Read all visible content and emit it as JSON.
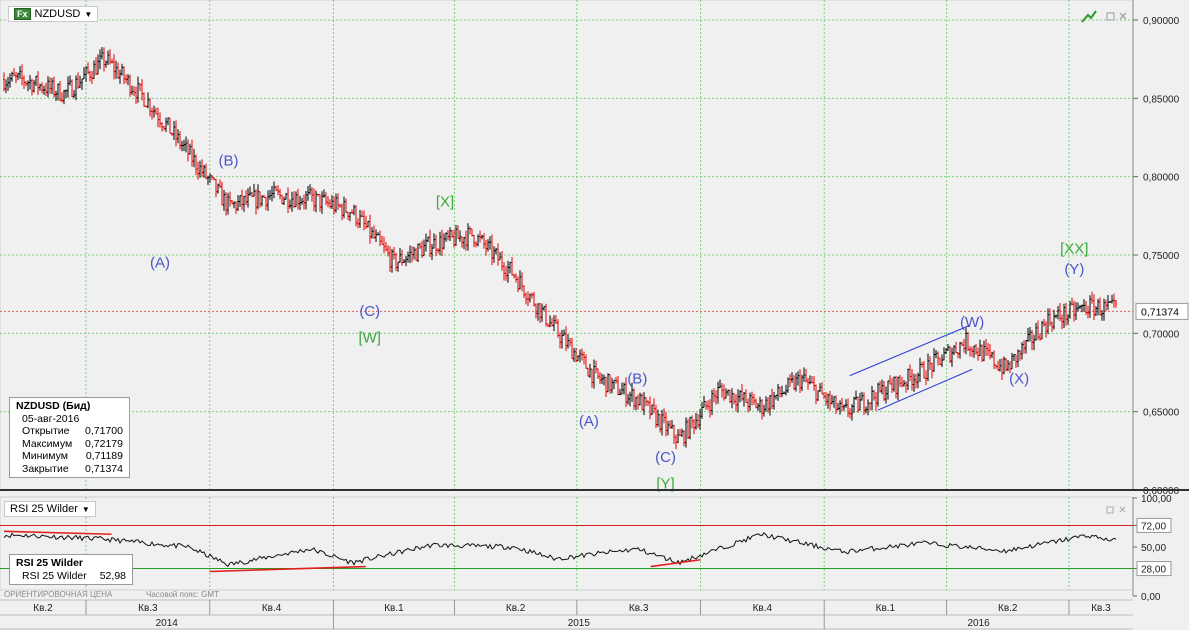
{
  "main_panel": {
    "symbol": "NZDUSD",
    "fx_icon_label": "Fx",
    "dropdown_icon": "triangle-down-icon",
    "toolbar_icons": [
      "trend-icon",
      "square-icon",
      "close-icon"
    ]
  },
  "info_box": {
    "title": "NZDUSD (Бид)",
    "date": "05-авг-2016",
    "rows": [
      {
        "label": "Открытие",
        "value": "0,71700"
      },
      {
        "label": "Максимум",
        "value": "0,72179"
      },
      {
        "label": "Минимум",
        "value": "0,71189"
      },
      {
        "label": "Закрытие",
        "value": "0,71374"
      }
    ]
  },
  "rsi_panel": {
    "label": "RSI 25 Wilder",
    "legend_title": "RSI 25 Wilder",
    "legend_label": "RSI 25 Wilder",
    "legend_value": "52,98",
    "level_high_label": "72,00",
    "level_low_label": "28,00",
    "axis_labels": [
      "100,00",
      "50,00",
      "0,00"
    ]
  },
  "footer": {
    "indicative_price": "ОРИЕНТИРОВОЧНАЯ ЦЕНА",
    "timezone": "Часовой пояс: GMT",
    "quarters": [
      "Кв.2",
      "Кв.3",
      "Кв.4",
      "Кв.1",
      "Кв.2",
      "Кв.3",
      "Кв.4",
      "Кв.1",
      "Кв.2",
      "Кв.3"
    ],
    "years": [
      "2014",
      "2015",
      "2016"
    ]
  },
  "colors": {
    "up_bar": "#000000",
    "down_bar": "#e00000",
    "wave_blue": "#4a55c8",
    "wave_green": "#3aa83a",
    "grid": "#7ccf7c",
    "price_line": "#e06060",
    "rsi_high": "#d02020",
    "rsi_low": "#20a020",
    "trend_red": "#e02020",
    "trend_blue": "#2838d8",
    "background": "#f0f0f0"
  },
  "chart_data": [
    {
      "type": "line",
      "series": [
        {
          "name": "NZDUSD",
          "x": [
            "2014-05",
            "2014-06",
            "2014-07",
            "2014-08",
            "2014-09",
            "2014-10",
            "2014-11",
            "2014-12",
            "2015-01",
            "2015-02",
            "2015-03",
            "2015-04",
            "2015-05",
            "2015-06",
            "2015-07",
            "2015-08",
            "2015-09",
            "2015-10",
            "2015-11",
            "2015-12",
            "2016-01",
            "2016-02",
            "2016-03",
            "2016-04",
            "2016-05",
            "2016-06",
            "2016-07",
            "2016-08"
          ],
          "values": [
            0.862,
            0.853,
            0.875,
            0.849,
            0.815,
            0.781,
            0.788,
            0.786,
            0.778,
            0.745,
            0.757,
            0.763,
            0.738,
            0.702,
            0.672,
            0.658,
            0.632,
            0.664,
            0.653,
            0.671,
            0.649,
            0.664,
            0.676,
            0.695,
            0.677,
            0.708,
            0.717,
            0.714
          ]
        }
      ],
      "ylim": [
        0.6,
        0.9
      ],
      "yticks": [
        "0,90000",
        "0,85000",
        "0,80000",
        "0,75000",
        "0,70000",
        "0,65000",
        "0,60000"
      ],
      "last_value_label": "0,71374",
      "annotations": [
        {
          "text": "(A)",
          "color": "blue",
          "x": "2014-08-25",
          "y": 0.742
        },
        {
          "text": "(B)",
          "color": "blue",
          "x": "2014-10-15",
          "y": 0.807
        },
        {
          "text": "[X]",
          "color": "green",
          "x": "2015-03-25",
          "y": 0.781
        },
        {
          "text": "(C)",
          "color": "blue",
          "x": "2015-01-28",
          "y": 0.711
        },
        {
          "text": "[W]",
          "color": "green",
          "x": "2015-01-28",
          "y": 0.694
        },
        {
          "text": "(B)",
          "color": "blue",
          "x": "2015-08-15",
          "y": 0.668
        },
        {
          "text": "(A)",
          "color": "blue",
          "x": "2015-07-10",
          "y": 0.641
        },
        {
          "text": "(C)",
          "color": "blue",
          "x": "2015-09-05",
          "y": 0.618
        },
        {
          "text": "[Y]",
          "color": "green",
          "x": "2015-09-05",
          "y": 0.601
        },
        {
          "text": "(W)",
          "color": "blue",
          "x": "2016-04-20",
          "y": 0.704
        },
        {
          "text": "(X)",
          "color": "blue",
          "x": "2016-05-25",
          "y": 0.668
        },
        {
          "text": "[XX]",
          "color": "green",
          "x": "2016-07-05",
          "y": 0.751
        },
        {
          "text": "(Y)",
          "color": "blue",
          "x": "2016-07-05",
          "y": 0.738
        }
      ]
    },
    {
      "type": "line",
      "series": [
        {
          "name": "RSI 25 Wilder",
          "x": [
            "2014-05",
            "2014-07",
            "2014-09",
            "2014-10",
            "2014-12",
            "2015-01",
            "2015-03",
            "2015-05",
            "2015-06",
            "2015-08",
            "2015-09",
            "2015-11",
            "2016-01",
            "2016-03",
            "2016-05",
            "2016-07",
            "2016-08"
          ],
          "values": [
            62,
            58,
            50,
            32,
            48,
            34,
            52,
            50,
            38,
            48,
            34,
            63,
            45,
            54,
            46,
            62,
            53
          ]
        }
      ],
      "ylim": [
        0,
        100
      ],
      "levels": [
        72,
        28
      ],
      "yticks": [
        "100,00",
        "72,00",
        "50,00",
        "28,00",
        "0,00"
      ]
    }
  ]
}
